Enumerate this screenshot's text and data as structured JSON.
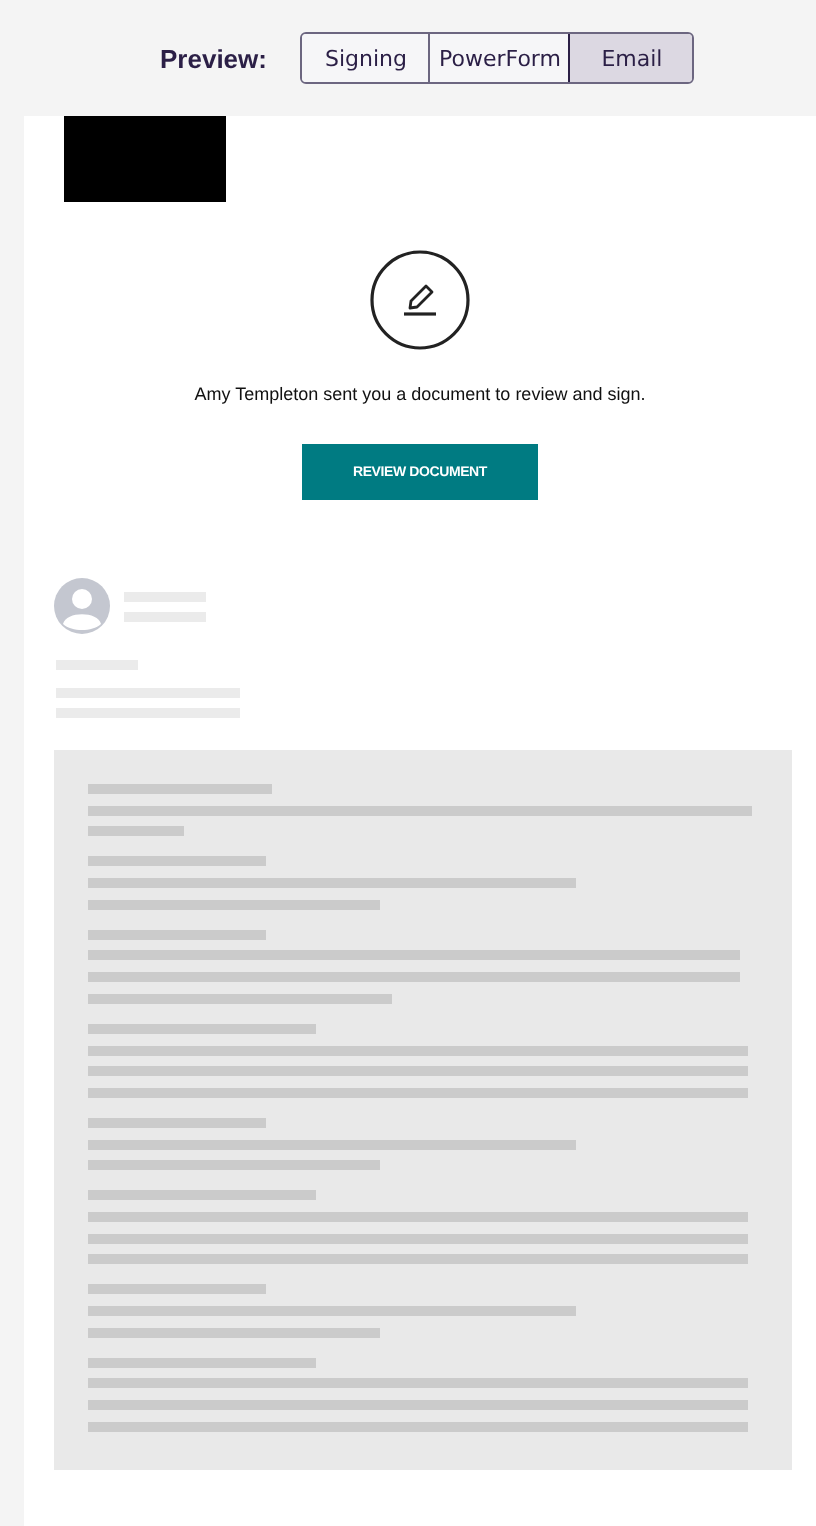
{
  "preview": {
    "label": "Preview:",
    "tabs": [
      {
        "label": "Signing",
        "selected": false
      },
      {
        "label": "PowerForm",
        "selected": false
      },
      {
        "label": "Email",
        "selected": true
      }
    ]
  },
  "email": {
    "message": "Amy Templeton sent you a document to review and sign.",
    "button": "REVIEW DOCUMENT"
  }
}
